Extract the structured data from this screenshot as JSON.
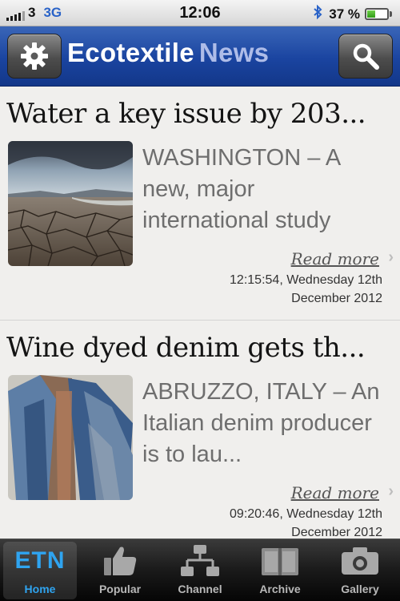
{
  "status_bar": {
    "carrier": "3",
    "network": "3G",
    "time": "12:06",
    "battery_percent_label": "37 %",
    "battery_level": 0.37
  },
  "header": {
    "brand_main": "Ecotextile",
    "brand_accent": "News",
    "settings_icon": "gear-icon",
    "search_icon": "search-icon"
  },
  "articles": [
    {
      "title": "Water a key issue by 203...",
      "summary": "WASHINGTON – A new, major international study",
      "read_more": "Read more",
      "timestamp_time": "12:15:54, Wednesday 12th",
      "timestamp_date": "December 2012"
    },
    {
      "title": "Wine dyed denim gets th...",
      "summary": "ABRUZZO, ITALY – An Italian denim producer is to lau...",
      "read_more": "Read more",
      "timestamp_time": "09:20:46, Wednesday 12th",
      "timestamp_date": "December 2012"
    }
  ],
  "tabbar": {
    "active": "home",
    "tabs": [
      {
        "id": "home",
        "label": "Home",
        "icon_text": "ETN"
      },
      {
        "id": "popular",
        "label": "Popular"
      },
      {
        "id": "channel",
        "label": "Channel"
      },
      {
        "id": "archive",
        "label": "Archive"
      },
      {
        "id": "gallery",
        "label": "Gallery"
      }
    ]
  },
  "colors": {
    "header_blue": "#1a44a0",
    "brand_accent": "#aebce8",
    "tab_active": "#2fa4f0"
  }
}
